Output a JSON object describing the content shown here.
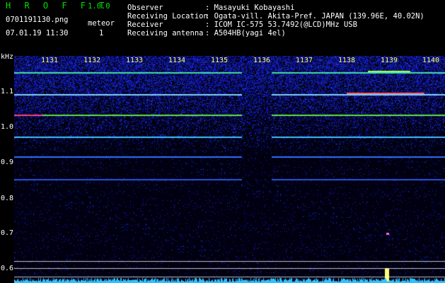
{
  "header": {
    "app_name": "H R O F F T",
    "version": "1.0.0",
    "filename": "0701191130.png",
    "datetime": "07.01.19 11:30",
    "meteor_label": "meteor",
    "meteor_count": "1",
    "labels": {
      "observer": "Observer",
      "location": "Receiving Location",
      "receiver": "Receiver",
      "antenna": "Receiving antenna"
    },
    "values": {
      "observer": ": Masayuki Kobayashi",
      "location": ": Ogata-vill. Akita-Pref. JAPAN (139.96E, 40.02N)",
      "receiver": ": ICOM IC-575 53.7492(@LCD)MHz USB",
      "antenna": ": A504HB(yagi 4el)"
    }
  },
  "axis": {
    "unit": "kHz",
    "y_ticks": [
      "1.1",
      "1.0",
      "0.9",
      "0.8",
      "0.7",
      "0.6"
    ],
    "x_ticks": [
      "1131",
      "1132",
      "1133",
      "1134",
      "1135",
      "1136",
      "1137",
      "1138",
      "1139",
      "1140"
    ]
  },
  "colors": {
    "background": "#000000",
    "header_green": "#00e000",
    "tick_yellow": "#ffff66",
    "noise_blue": "#1a2cc8"
  }
}
